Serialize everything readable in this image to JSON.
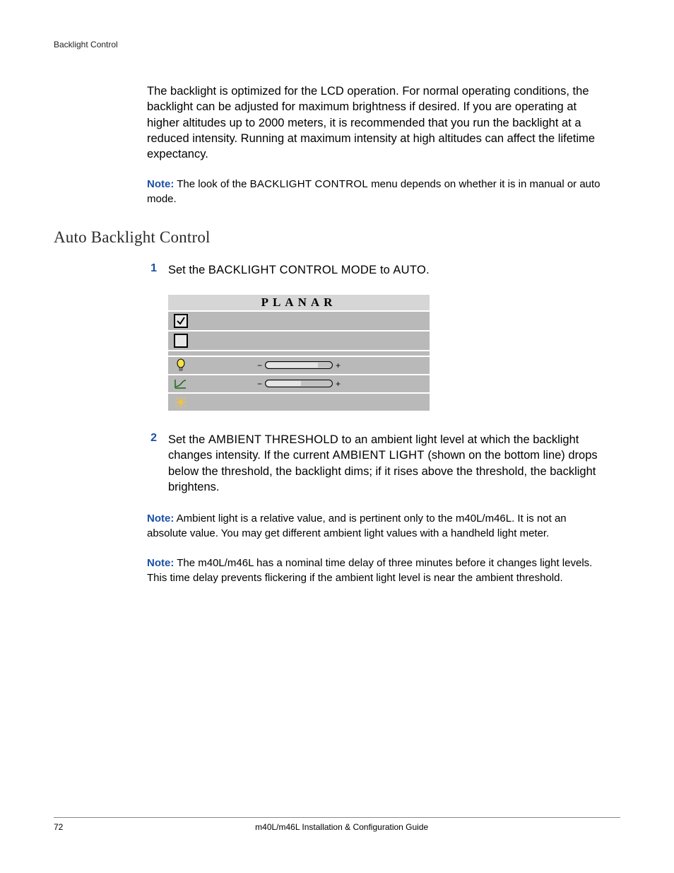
{
  "header": {
    "breadcrumb": "Backlight Control"
  },
  "intro": {
    "para": "The backlight is optimized for the LCD operation. For normal operating conditions, the backlight can be adjusted for maximum brightness if desired. If you are operating at higher altitudes up to 2000 meters, it is recommended that you run the backlight at a reduced intensity. Running at maximum intensity at high altitudes can affect the lifetime expectancy."
  },
  "note1": {
    "label": "Note:",
    "before": " The look of the ",
    "sc": "BACKLIGHT CONTROL",
    "after": " menu depends on whether it is in manual or auto mode."
  },
  "section": {
    "title": "Auto Backlight Control"
  },
  "step1": {
    "num": "1",
    "before": "Set the ",
    "sc1": "BACKLIGHT CONTROL MODE",
    "mid": " to ",
    "sc2": "AUTO",
    "after": "."
  },
  "menu": {
    "brand": "PLANAR",
    "slider1_fill_pct": 78,
    "slider2_fill_pct": 52,
    "minus": "−",
    "plus": "+"
  },
  "step2": {
    "num": "2",
    "before": "Set the ",
    "sc1": "AMBIENT THRESHOLD",
    "mid1": " to an ambient light level at which the backlight changes intensity. If the current ",
    "sc2": "AMBIENT LIGHT",
    "after": " (shown on the bottom line) drops below the threshold, the backlight dims; if it rises above the threshold, the backlight brightens."
  },
  "note2": {
    "label": "Note:",
    "text": " Ambient light is a relative value, and is pertinent only to the m40L/m46L. It is not an absolute value. You may get different ambient light values with a handheld light meter."
  },
  "note3": {
    "label": "Note:",
    "text": " The m40L/m46L has a nominal time delay of three minutes before it changes light levels. This time delay prevents flickering if the ambient light level is near the ambient threshold."
  },
  "footer": {
    "pageno": "72",
    "title": "m40L/m46L Installation & Configuration Guide"
  }
}
